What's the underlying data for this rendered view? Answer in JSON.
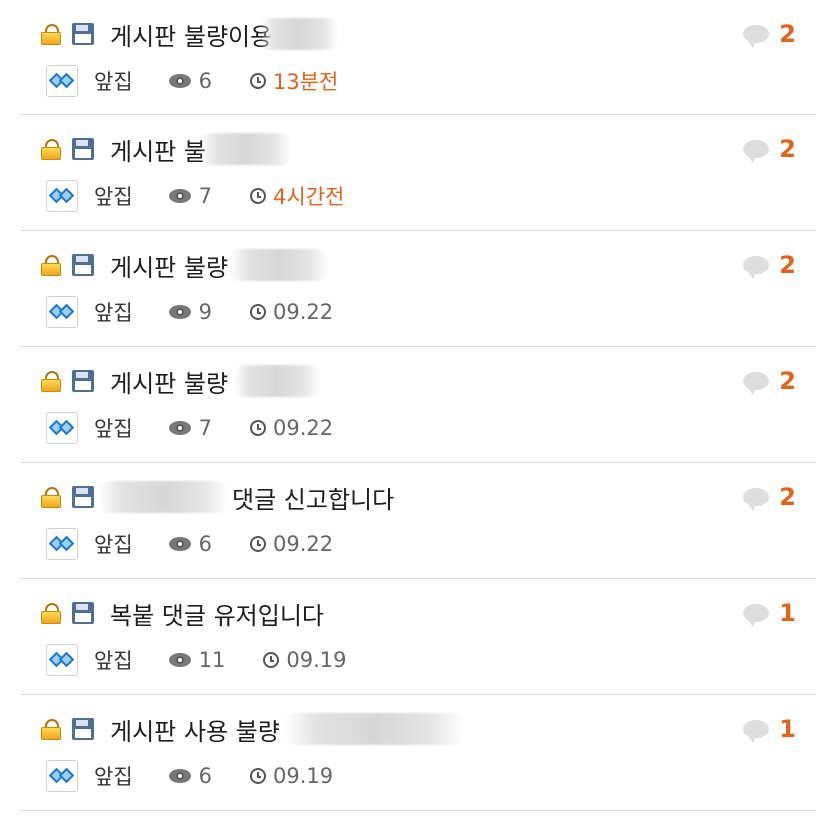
{
  "posts": [
    {
      "title": "게시판 불량이용",
      "blurred": "",
      "comments": "2",
      "author": "앞집",
      "views": "6",
      "time": "13분전",
      "recent": true
    },
    {
      "title": "게시판 불",
      "blurred": "",
      "comments": "2",
      "author": "앞집",
      "views": "7",
      "time": "4시간전",
      "recent": true
    },
    {
      "title": "게시판 불량",
      "blurred": "",
      "comments": "2",
      "author": "앞집",
      "views": "9",
      "time": "09.22",
      "recent": false
    },
    {
      "title": "게시판 불량",
      "blurred": "",
      "comments": "2",
      "author": "앞집",
      "views": "7",
      "time": "09.22",
      "recent": false
    },
    {
      "title": "",
      "blurred": "",
      "title_after": "댓글 신고합니다",
      "comments": "2",
      "author": "앞집",
      "views": "6",
      "time": "09.22",
      "recent": false
    },
    {
      "title": "복붙 댓글 유저입니다",
      "blurred": "",
      "comments": "1",
      "author": "앞집",
      "views": "11",
      "time": "09.19",
      "recent": false
    },
    {
      "title": "게시판 사용 불량",
      "blurred": "",
      "comments": "1",
      "author": "앞집",
      "views": "6",
      "time": "09.19",
      "recent": false
    }
  ],
  "icons": {
    "lock": "lock-icon",
    "disk": "save-icon",
    "comment": "comment-bubble-icon",
    "avatar": "avatar-icon",
    "views": "eye-icon",
    "time": "clock-icon"
  },
  "colors": {
    "accent": "#e0641c",
    "meta_text": "#666666",
    "divider": "#dcdcdc"
  }
}
